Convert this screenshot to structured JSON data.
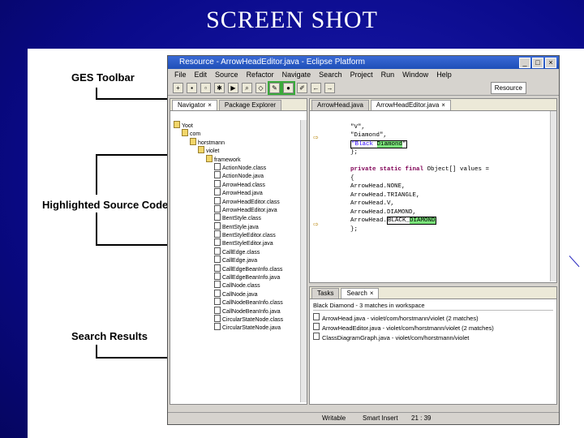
{
  "slide": {
    "title": "SCREEN SHOT"
  },
  "callouts": {
    "toolbar": "GES Toolbar",
    "source": "Highlighted Source Code",
    "search": "Search Results"
  },
  "window": {
    "title": "Resource - ArrowHeadEditor.java - Eclipse Platform",
    "buttons": [
      "_",
      "□",
      "×"
    ]
  },
  "menu": [
    "File",
    "Edit",
    "Source",
    "Refactor",
    "Navigate",
    "Search",
    "Project",
    "Run",
    "Window",
    "Help"
  ],
  "perspective": "Resource",
  "navigator": {
    "tabs": [
      "Navigator",
      "Package Explorer"
    ],
    "items": [
      {
        "label": "Yoot",
        "indent": 0,
        "folder": true
      },
      {
        "label": "com",
        "indent": 1,
        "folder": true
      },
      {
        "label": "horstmann",
        "indent": 2,
        "folder": true
      },
      {
        "label": "violet",
        "indent": 3,
        "folder": true
      },
      {
        "label": "framework",
        "indent": 4,
        "folder": true
      },
      {
        "label": "ActionNode.class",
        "indent": 5
      },
      {
        "label": "ActionNode.java",
        "indent": 5
      },
      {
        "label": "ArrowHead.class",
        "indent": 5
      },
      {
        "label": "ArrowHead.java",
        "indent": 5
      },
      {
        "label": "ArrowHeadEditor.class",
        "indent": 5
      },
      {
        "label": "ArrowHeadEditor.java",
        "indent": 5
      },
      {
        "label": "BentStyle.class",
        "indent": 5
      },
      {
        "label": "BentStyle.java",
        "indent": 5
      },
      {
        "label": "BentStyleEditor.class",
        "indent": 5
      },
      {
        "label": "BentStyleEditor.java",
        "indent": 5
      },
      {
        "label": "CallEdge.class",
        "indent": 5
      },
      {
        "label": "CallEdge.java",
        "indent": 5
      },
      {
        "label": "CallEdgeBeanInfo.class",
        "indent": 5
      },
      {
        "label": "CallEdgeBeanInfo.java",
        "indent": 5
      },
      {
        "label": "CallNode.class",
        "indent": 5
      },
      {
        "label": "CallNode.java",
        "indent": 5
      },
      {
        "label": "CallNodeBeanInfo.class",
        "indent": 5
      },
      {
        "label": "CallNodeBeanInfo.java",
        "indent": 5
      },
      {
        "label": "CircularStateNode.class",
        "indent": 5
      },
      {
        "label": "CircularStateNode.java",
        "indent": 5
      }
    ]
  },
  "editor": {
    "tabs": [
      "ArrowHead.java",
      "ArrowHeadEditor.java"
    ],
    "lines": {
      "l1": "\"V\",",
      "l2": "\"Diamond\",",
      "l3a": "\"Black ",
      "l3b": "Diamond",
      "l3c": "\"",
      "l4": "};",
      "l5kw": "private static final ",
      "l5": "Object[] values =",
      "l6": "{",
      "l7": "ArrowHead.NONE,",
      "l8": "ArrowHead.TRIANGLE,",
      "l9": "ArrowHead.V,",
      "l10": "ArrowHead.DIAMOND,",
      "l11a": "ArrowHead.",
      "l11b": "BLACK",
      "l11c": "_",
      "l11d": "DIAMOND",
      "l12": "};"
    }
  },
  "search": {
    "tabs": [
      "Tasks",
      "Search"
    ],
    "header": "Black Diamond - 3 matches in workspace",
    "results": [
      "ArrowHead.java - violet/com/horstmann/violet (2 matches)",
      "ArrowHeadEditor.java - violet/com/horstmann/violet (2 matches)",
      "ClassDiagramGraph.java - violet/com/horstmann/violet"
    ]
  },
  "status": {
    "mode": "Writable",
    "insert": "Smart Insert",
    "position": "21 : 39"
  }
}
